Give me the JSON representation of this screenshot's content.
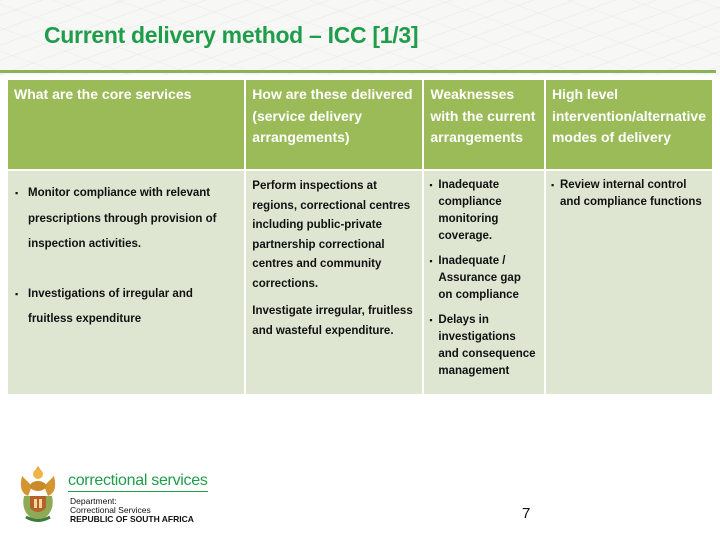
{
  "slide": {
    "title": "Current delivery method – ICC [1/3]",
    "page_number": "7"
  },
  "table": {
    "headers": [
      "What are the core services",
      "How are these delivered (service delivery arrangements)",
      "Weaknesses with the current arrangements",
      "High level intervention/alternative modes of delivery"
    ],
    "core_services": [
      "Monitor compliance with relevant prescriptions through provision of inspection activities.",
      "Investigations of irregular and fruitless expenditure"
    ],
    "delivery": [
      "Perform inspections at regions, correctional centres including public-private partnership correctional centres and community corrections.",
      "Investigate irregular, fruitless and wasteful expenditure."
    ],
    "weaknesses": [
      "Inadequate compliance monitoring coverage.",
      "Inadequate / Assurance gap on compliance",
      "Delays in investigations and consequence management"
    ],
    "interventions": [
      "Review internal control and compliance functions"
    ]
  },
  "logo": {
    "brand": "correctional services",
    "line1": "Department:",
    "line2": "Correctional Services",
    "line3": "REPUBLIC OF SOUTH AFRICA"
  },
  "colors": {
    "title": "#1f9d4a",
    "header_bg": "#9bbb59",
    "cell_bg": "#dee6d2",
    "rule": "#8db255"
  }
}
